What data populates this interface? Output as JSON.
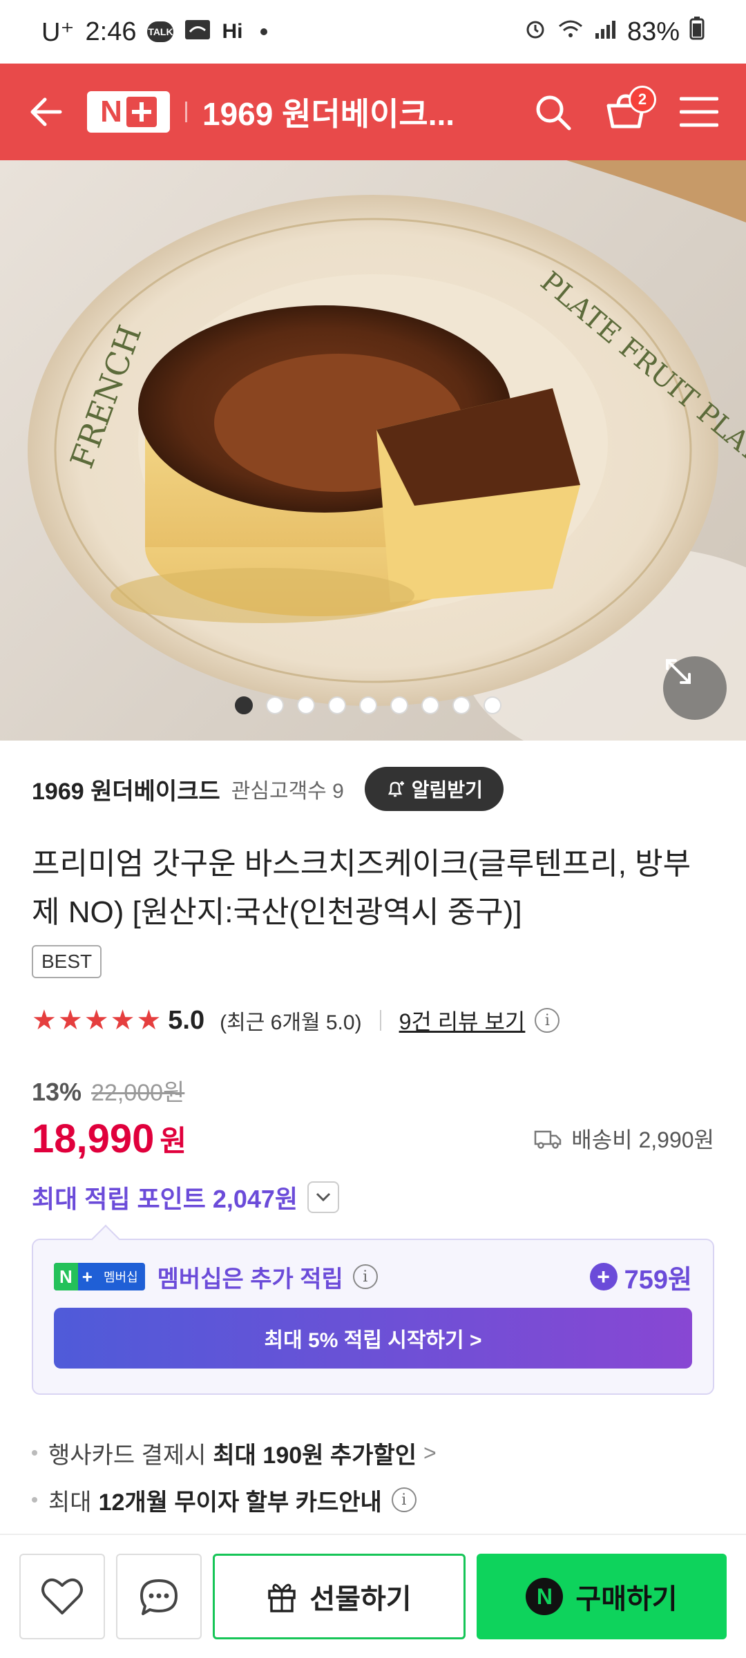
{
  "status_bar": {
    "carrier": "U⁺",
    "time": "2:46",
    "talk_badge": "TALK",
    "hi_text": "Hi",
    "battery": "83%"
  },
  "header": {
    "title": "1969 원더베이크...",
    "cart_count": "2"
  },
  "hero": {
    "plate_text_left": "FRENCH",
    "plate_text_right": "PLATE FRUIT PLATE IS DELICIOUS",
    "page_count": 9,
    "active_page": 1
  },
  "store": {
    "name": "1969 원더베이크드",
    "followers": "관심고객수 9",
    "notify_label": "알림받기"
  },
  "product": {
    "title": "프리미엄 갓구운 바스크치즈케이크(글루텐프리, 방부제 NO) [원산지:국산(인천광역시 중구)]",
    "badge": "BEST"
  },
  "rating": {
    "stars": 5,
    "score": "5.0",
    "recent": "(최근 6개월 5.0)",
    "review_link": "9건 리뷰 보기"
  },
  "price": {
    "discount_rate": "13%",
    "original": "22,000원",
    "current": "18,990",
    "unit": "원",
    "shipping": "배송비 2,990원",
    "points": "최대 적립 포인트 2,047원"
  },
  "membership": {
    "badge_n": "N",
    "badge_plus": "+",
    "badge_label": "멤버십",
    "text": "멤버십은 추가 적립",
    "amount": "759원",
    "cta": "최대 5% 적립 시작하기 >"
  },
  "benefits": [
    {
      "prefix": "행사카드 결제시",
      "bold": "최대 190원 추가할인",
      "suffix": ">"
    },
    {
      "prefix": "최대",
      "bold": "12개월 무이자 할부 카드안내",
      "suffix": ""
    }
  ],
  "bottom": {
    "gift_label": "선물하기",
    "buy_label": "구매하기",
    "buy_icon": "N"
  },
  "colors": {
    "header_red": "#e84a4a",
    "price_red": "#e0003c",
    "purple": "#6b4bd9",
    "buy_green": "#0ed35c"
  }
}
